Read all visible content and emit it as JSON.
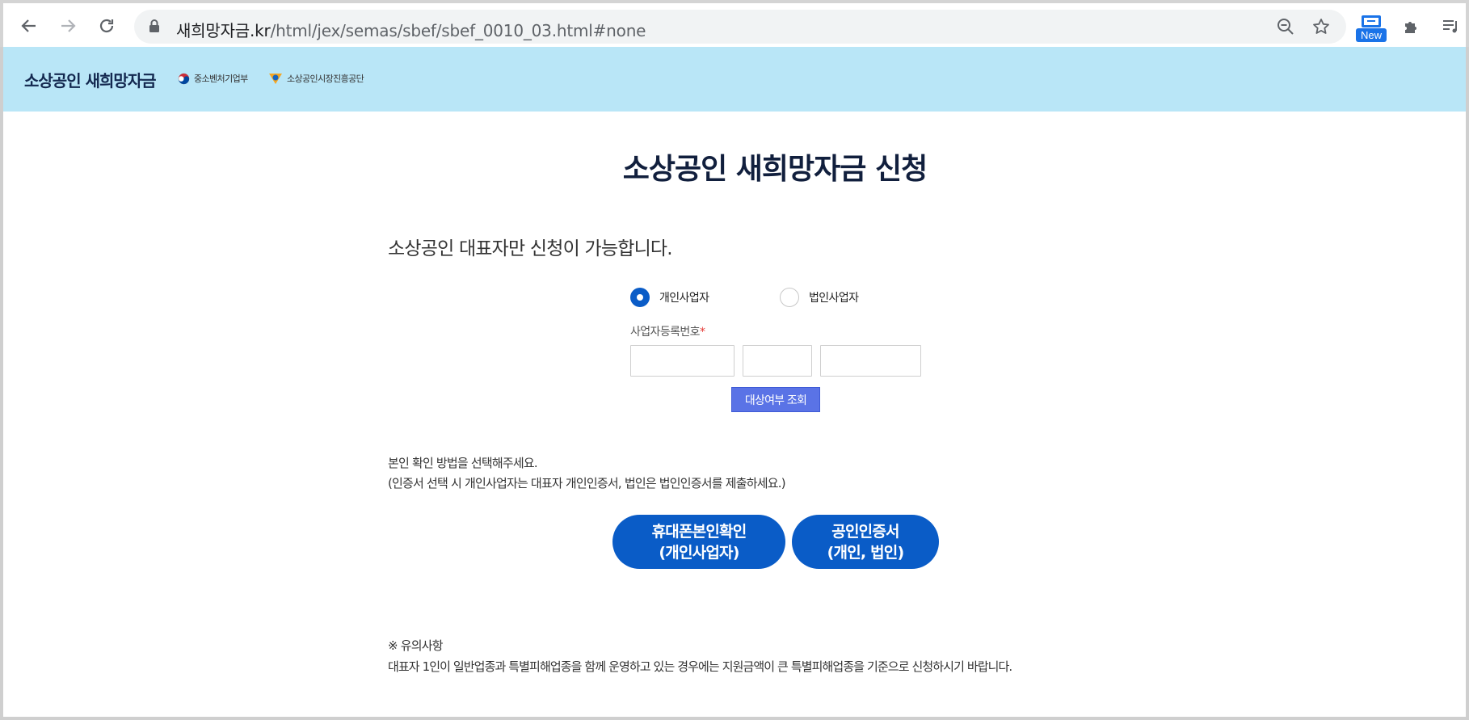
{
  "browser": {
    "url_host": "새희망자금.kr",
    "url_path": "/html/jex/semas/sbef/sbef_0010_03.html#none",
    "extension_badge": "New",
    "icons": [
      "back-icon",
      "forward-icon",
      "reload-icon",
      "lock-icon",
      "zoom-out-icon",
      "star-icon",
      "extension-new-icon",
      "puzzle-icon",
      "media-queue-icon"
    ]
  },
  "header": {
    "brand": "소상공인 새희망자금",
    "ministry": "중소벤처기업부",
    "agency": "소상공인시장진흥공단",
    "background": "#b9e6f7"
  },
  "main": {
    "title": "소상공인 새희망자금 신청",
    "notice": "소상공인 대표자만 신청이 가능합니다.",
    "business_type": {
      "options": [
        "개인사업자",
        "법인사업자"
      ],
      "selected": "개인사업자"
    },
    "biz_number": {
      "label": "사업자등록번호",
      "required_mark": "*",
      "values": [
        "",
        "",
        ""
      ]
    },
    "check_button": "대상여부 조회",
    "method_line1": "본인 확인 방법을 선택해주세요.",
    "method_line2": "(인증서 선택 시 개인사업자는 대표자 개인인증서, 법인은 법인인증서를 제출하세요.)",
    "auth_buttons": [
      {
        "line1": "휴대폰본인확인",
        "line2": "(개인사업자)"
      },
      {
        "line1": "공인인증서",
        "line2": "(개인, 법인)"
      }
    ],
    "caution_title": "※ 유의사항",
    "caution_text": "대표자 1인이 일반업종과 특별피해업종을 함께 운영하고 있는 경우에는 지원금액이 큰 특별피해업종을 기준으로 신청하시기 바랍니다.",
    "accent_color": "#0a5cc7"
  }
}
